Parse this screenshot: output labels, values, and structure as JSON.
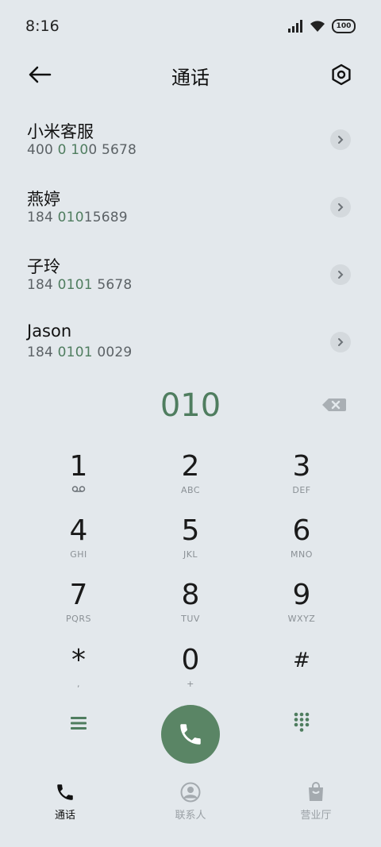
{
  "status_bar": {
    "time": "8:16",
    "battery": "100"
  },
  "header": {
    "title": "通话"
  },
  "contacts": [
    {
      "name": "小米客服",
      "number_pre": "400 ",
      "number_hl": "0",
      "number_post": " 100 5678",
      "parts": [
        "400 ",
        "0",
        " ",
        "10",
        "0 5678"
      ]
    },
    {
      "name": "燕婷",
      "parts": [
        "184 ",
        "010",
        "15689"
      ]
    },
    {
      "name": "子玲",
      "parts": [
        "184 ",
        "0101",
        " 5678"
      ]
    },
    {
      "name": "Jason",
      "parts": [
        "184 ",
        "0101",
        " 0029"
      ]
    }
  ],
  "dial": {
    "number": "010"
  },
  "keypad": [
    {
      "digit": "1",
      "sub": ""
    },
    {
      "digit": "2",
      "sub": "ABC"
    },
    {
      "digit": "3",
      "sub": "DEF"
    },
    {
      "digit": "4",
      "sub": "GHI"
    },
    {
      "digit": "5",
      "sub": "JKL"
    },
    {
      "digit": "6",
      "sub": "MNO"
    },
    {
      "digit": "7",
      "sub": "PQRS"
    },
    {
      "digit": "8",
      "sub": "TUV"
    },
    {
      "digit": "9",
      "sub": "WXYZ"
    },
    {
      "digit": "*",
      "sub": ","
    },
    {
      "digit": "0",
      "sub": "+"
    },
    {
      "digit": "#",
      "sub": ""
    }
  ],
  "bottom_nav": [
    {
      "label": "通话",
      "icon": "phone-icon",
      "active": true
    },
    {
      "label": "联系人",
      "icon": "person-icon",
      "active": false
    },
    {
      "label": "营业厅",
      "icon": "shopping-bag-icon",
      "active": false
    }
  ],
  "colors": {
    "accent": "#5a8565",
    "highlight": "#4f7d5f",
    "background": "#e3e8ec"
  }
}
